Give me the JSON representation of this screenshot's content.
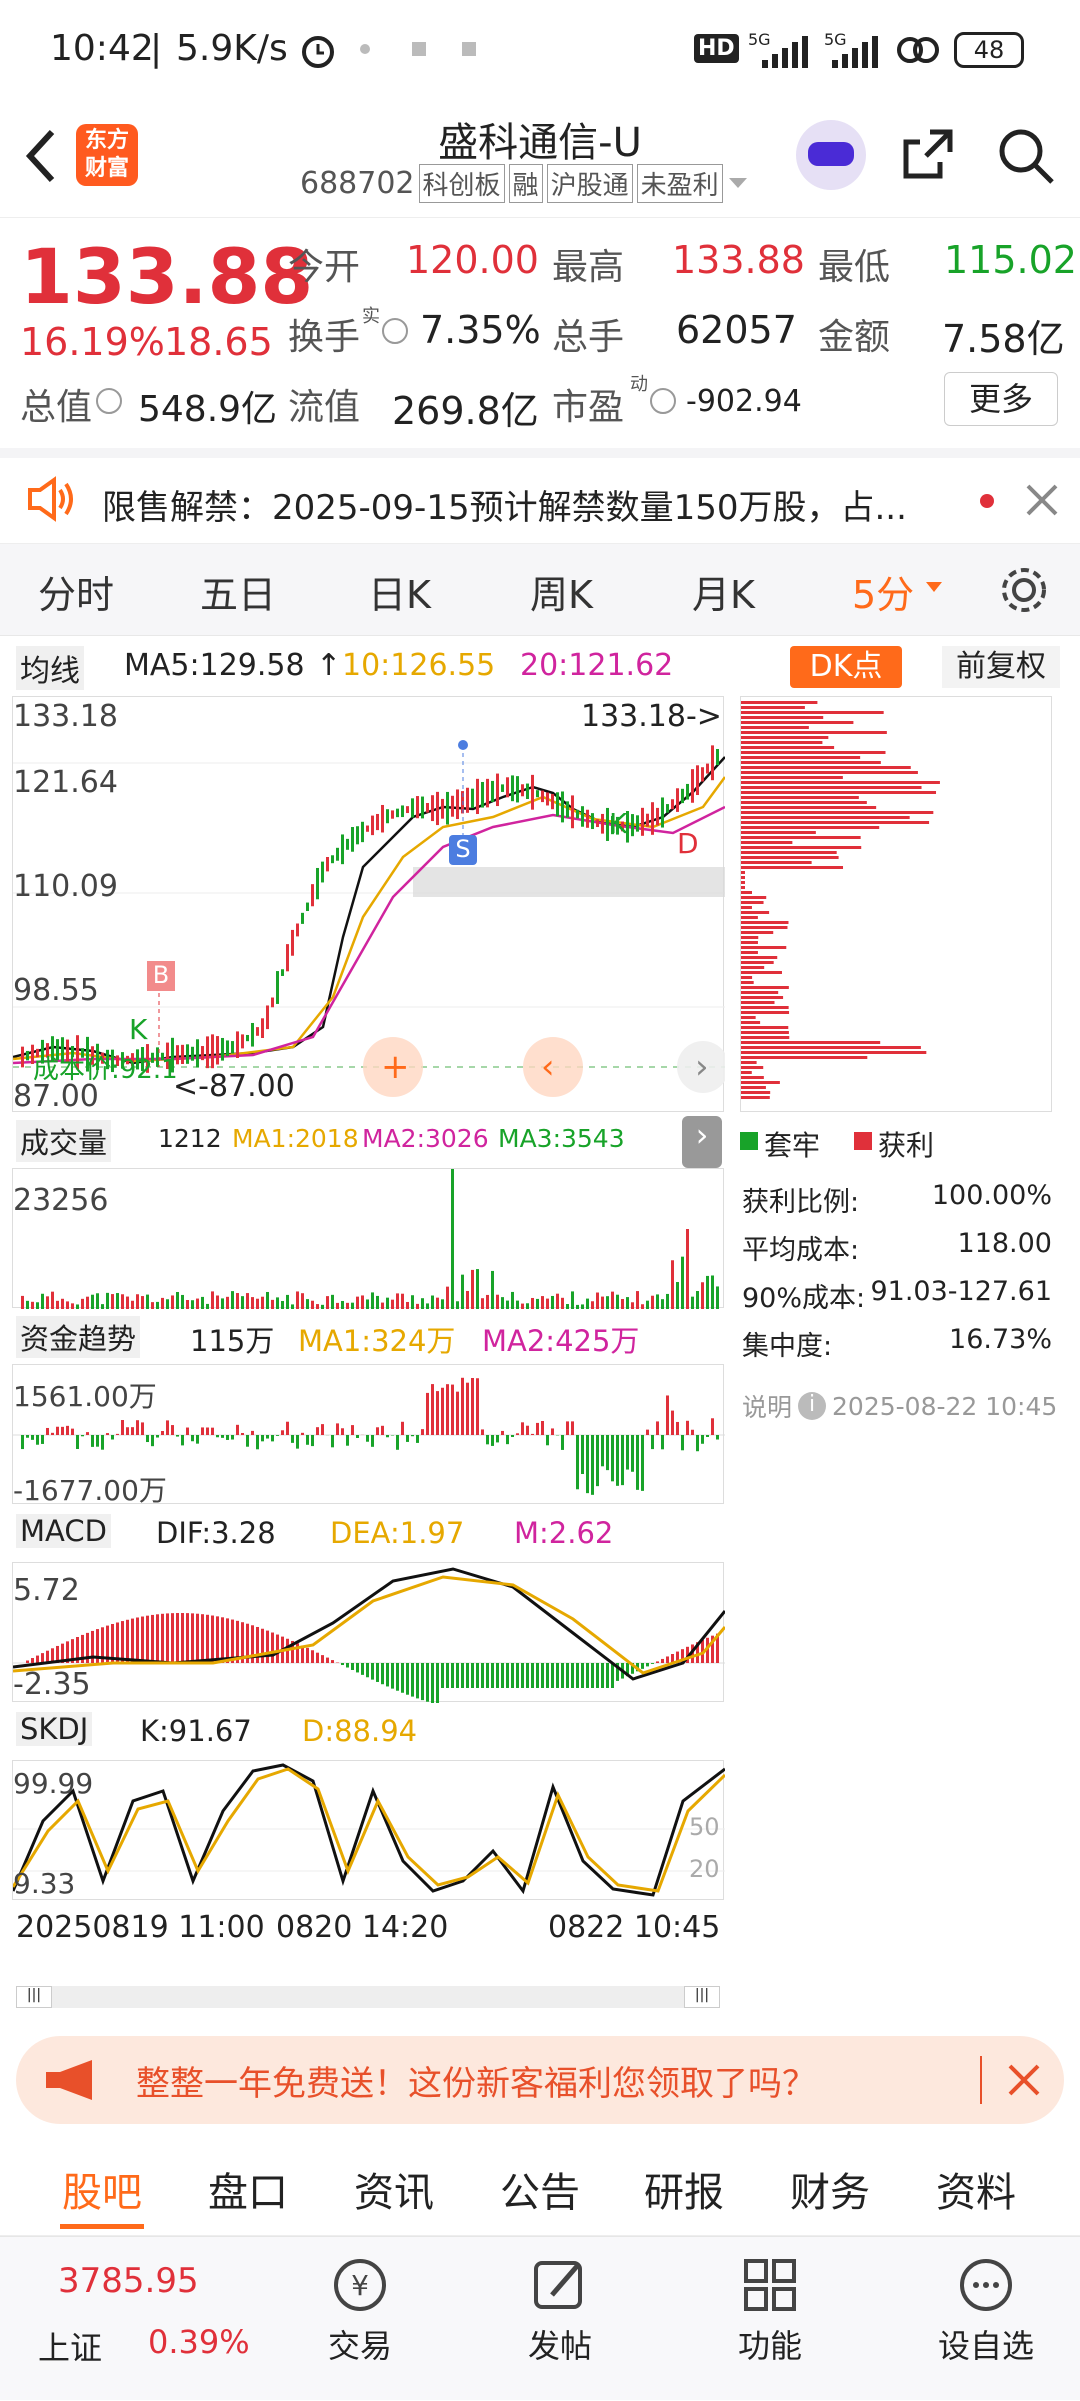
{
  "status": {
    "time": "10:42",
    "speed": "5.9K/s",
    "battery": "48",
    "hd": "HD",
    "net1": "5G",
    "net2": "5G"
  },
  "header": {
    "logo_line1": "东方",
    "logo_line2": "财富",
    "title": "盛科通信-U",
    "code": "688702",
    "tags": [
      "科创板",
      "融",
      "沪股通",
      "未盈利"
    ]
  },
  "quote": {
    "price": "133.88",
    "pct": "16.19%",
    "change": "18.65",
    "open_label": "今开",
    "open": "120.00",
    "high_label": "最高",
    "high": "133.88",
    "low_label": "最低",
    "low": "115.02",
    "turnover_label": "换手",
    "turnover_sup": "实",
    "turnover": "7.35%",
    "vol_label": "总手",
    "vol": "62057",
    "amount_label": "金额",
    "amount": "7.58亿",
    "mcap_label": "总值",
    "mcap": "548.9亿",
    "float_label": "流值",
    "float": "269.8亿",
    "pe_label": "市盈",
    "pe_sup": "动",
    "pe": "-902.94",
    "more": "更多"
  },
  "notice": {
    "text": "限售解禁：2025-09-15预计解禁数量150万股，占..."
  },
  "tabs": [
    "分时",
    "五日",
    "日K",
    "周K",
    "月K",
    "5分"
  ],
  "kline": {
    "ma_selector": "均线",
    "ma5": "MA5:129.58",
    "ma10": "10:126.55",
    "ma20": "20:121.62",
    "dk": "DK点",
    "fq": "前复权",
    "y_labels": [
      "133.18",
      "121.64",
      "110.09",
      "98.55",
      "87.00"
    ],
    "max_tag": "133.18->",
    "min_tag": "<-87.00",
    "cost_tag": "成本价:92.1",
    "b_mark": "B",
    "s_mark": "S",
    "k_mark": "K",
    "d_mark": "D"
  },
  "chip": {
    "legend_loss": "套牢",
    "legend_profit": "获利",
    "rows": [
      {
        "k": "获利比例:",
        "v": "100.00%"
      },
      {
        "k": "平均成本:",
        "v": "118.00"
      },
      {
        "k": "90%成本:",
        "v": "91.03-127.61"
      },
      {
        "k": "集中度:",
        "v": "16.73%"
      }
    ],
    "note": "说明",
    "note_time": "2025-08-22 10:45"
  },
  "volume": {
    "sel": "成交量",
    "v": "1212",
    "ma1": "MA1:2018",
    "ma2": "MA2:3026",
    "ma3": "MA3:3543",
    "top": "23256"
  },
  "fund": {
    "sel": "资金趋势",
    "v": "115万",
    "ma1": "MA1:324万",
    "ma2": "MA2:425万",
    "top": "1561.00万",
    "bot": "-1677.00万"
  },
  "macd": {
    "sel": "MACD",
    "dif": "DIF:3.28",
    "dea": "DEA:1.97",
    "m": "M:2.62",
    "top": "5.72",
    "bot": "-2.35"
  },
  "skdj": {
    "sel": "SKDJ",
    "k": "K:91.67",
    "d": "D:88.94",
    "top": "99.99",
    "bot": "9.33",
    "l50": "50",
    "l20": "20"
  },
  "xaxis": [
    "20250819 11:00",
    "0820 14:20",
    "0822 10:45"
  ],
  "ad": {
    "text": "整整一年免费送！这份新客福利您领取了吗？"
  },
  "bottom_tabs": [
    "股吧",
    "盘口",
    "资讯",
    "公告",
    "研报",
    "财务",
    "资料"
  ],
  "bottom_bar": {
    "index_val": "3785.95",
    "index_name": "上证",
    "index_pct": "0.39%",
    "items": [
      "交易",
      "发帖",
      "功能",
      "设自选"
    ]
  },
  "colors": {
    "up": "#e0303a",
    "down": "#18a329",
    "accent": "#ff6a1a",
    "ma10": "#e6a800",
    "ma20": "#d0249e"
  }
}
